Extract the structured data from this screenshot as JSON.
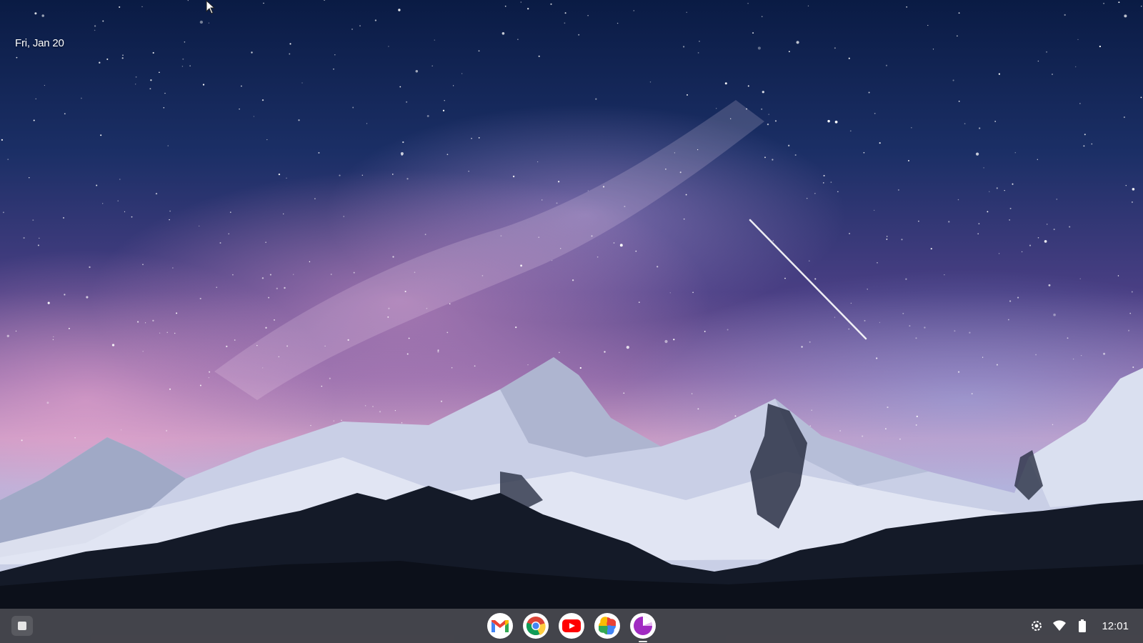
{
  "desktop": {
    "date": "Fri, Jan 20"
  },
  "shelf": {
    "launcher_icon": "launcher-icon",
    "pinned_apps": [
      {
        "name": "Gmail",
        "icon": "gmail-icon"
      },
      {
        "name": "Chrome",
        "icon": "chrome-icon"
      },
      {
        "name": "YouTube",
        "icon": "youtube-icon"
      },
      {
        "name": "Google Photos",
        "icon": "photos-icon"
      },
      {
        "name": "Screen Capture",
        "icon": "pie-app-icon",
        "running": true
      }
    ],
    "tray": {
      "icons": [
        "settings-icon",
        "wifi-icon",
        "battery-icon"
      ],
      "time": "12:01"
    }
  },
  "colors": {
    "shelf": "#46464c",
    "sky_top": "#0a1b44",
    "sky_glow": "#c79ac4"
  }
}
